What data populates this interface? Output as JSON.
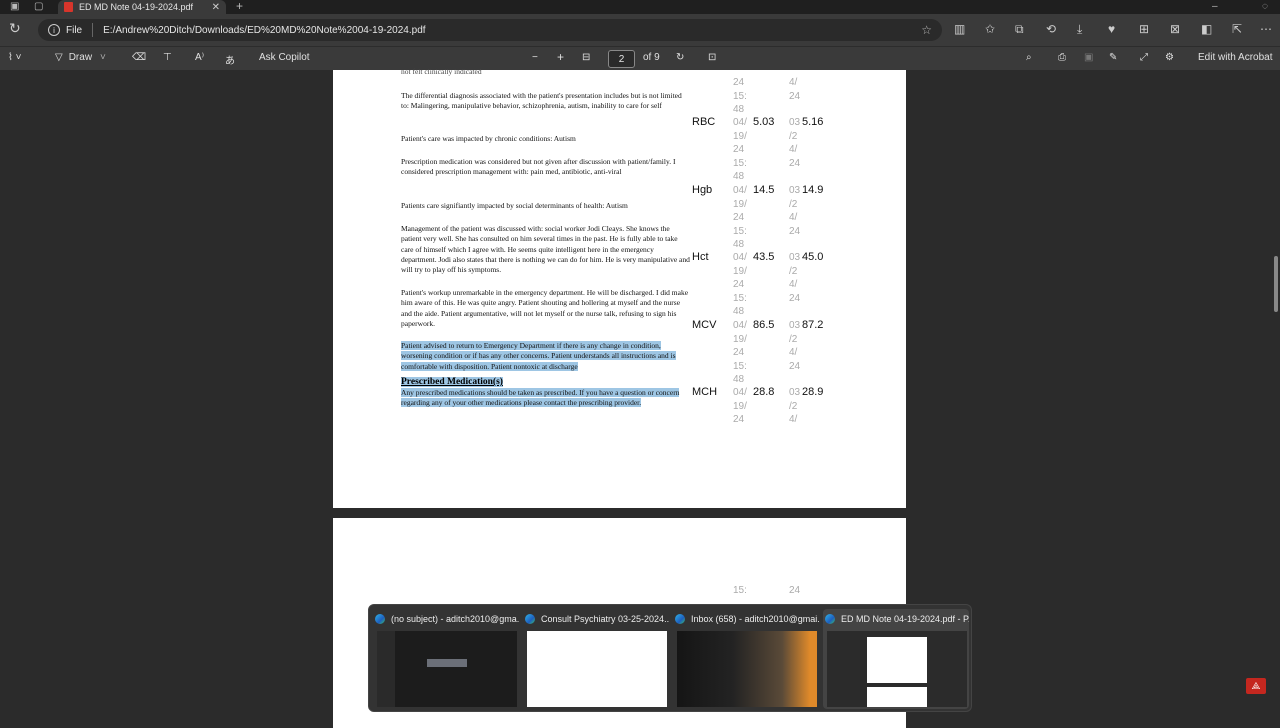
{
  "tab": {
    "title": "ED MD Note 04-19-2024.pdf",
    "close": "✕",
    "new": "+"
  },
  "address": {
    "label": "File",
    "url": "E:/Andrew%20Ditch/Downloads/ED%20MD%20Note%2004-19-2024.pdf"
  },
  "pdf_toolbar": {
    "draw": "Draw",
    "copilot": "Ask Copilot",
    "zoom_out": "−",
    "zoom_in": "+",
    "page_current": "2",
    "page_total": "of 9",
    "edit": "Edit with Acrobat"
  },
  "document": {
    "cut_top_line": "not felt clinically indicated",
    "paragraphs": [
      "The differential diagnosis associated with the patient's presentation includes but is not limited to: Malingering, manipulative behavior, schizophrenia, autism, inability to care for self",
      "Patient's care was impacted by chronic conditions: Autism",
      "Prescription medication was considered but not given after discussion with patient/family.  I considered prescription management with:  pain med, antibiotic, anti-viral",
      "Patients care signifiantly impacted by social determinants of health: Autism",
      "Management of the patient was discussed with: social worker Jodi Cleays.  She knows the patient very well.  She has consulted on him several times in the past.  He is fully able to take care of himself which I agree with.  He seems quite intelligent here in the emergency department.  Jodi also states that there is nothing we can do for him.  He is very manipulative and will try to play off his symptoms.",
      "Patient's workup unremarkable in the emergency department.  He will be discharged.  I did make him aware of this.  He was quite angry.  Patient shouting and hollering at myself and the nurse and the aide.  Patient argumentative, will not let myself or the nurse talk, refusing to sign his paperwork."
    ],
    "highlighted_paragraph": "Patient advised to return to Emergency Department if there is any change in condition, worsening condition or if has any other concerns. Patient understands all instructions and is comfortable with disposition. Patient nontoxic at discharge",
    "rx_title": "Prescribed Medication(s)",
    "rx_text": "Any prescribed medications should be taken as prescribed. If you have a question or concern regarding any of your other medications please contact the prescribing provider."
  },
  "labs": [
    {
      "name": "RBC",
      "v1": "5.03",
      "v2": "5.16"
    },
    {
      "name": "Hgb",
      "v1": "14.5",
      "v2": "14.9"
    },
    {
      "name": "Hct",
      "v1": "43.5",
      "v2": "45.0"
    },
    {
      "name": "MCV",
      "v1": "86.5",
      "v2": "87.2"
    },
    {
      "name": "MCH",
      "v1": "28.8",
      "v2": "28.9"
    }
  ],
  "date_fragments": {
    "col1": [
      "24",
      "15:",
      "48",
      "04/",
      "19/",
      "24"
    ],
    "col2": [
      "4/",
      "24",
      "03",
      "/2"
    ],
    "page2": [
      "15:",
      "24"
    ]
  },
  "taskbar_previews": [
    {
      "title": "(no subject) - aditch2010@gma..."
    },
    {
      "title": "Consult Psychiatry 03-25-2024...."
    },
    {
      "title": "Inbox (658) - aditch2010@gmai..."
    },
    {
      "title": "ED MD Note 04-19-2024.pdf - P..."
    }
  ]
}
